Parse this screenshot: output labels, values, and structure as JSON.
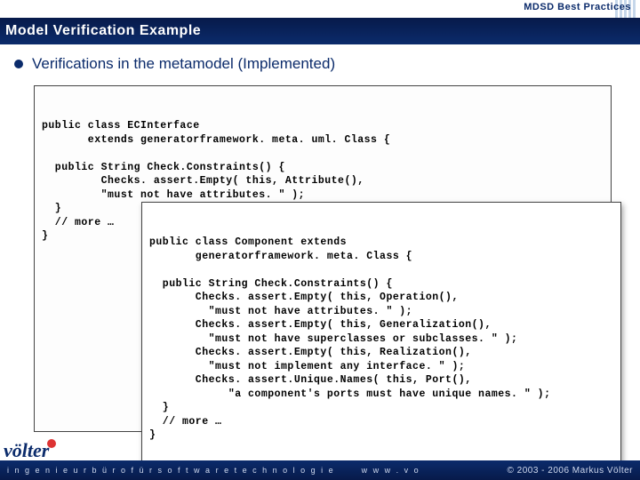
{
  "header": {
    "label": "MDSD Best Practices"
  },
  "title": "Model Verification Example",
  "bullet": "Verifications in the metamodel (Implemented)",
  "code_outer": "public class ECInterface\n       extends generatorframework. meta. uml. Class {\n\n  public String Check.Constraints() {\n         Checks. assert.Empty( this, Attribute(),\n         \"must not have attributes. \" );\n  }\n  // more …\n}",
  "code_inner": "public class Component extends\n       generatorframework. meta. Class {\n\n  public String Check.Constraints() {\n       Checks. assert.Empty( this, Operation(),\n         \"must not have attributes. \" );\n       Checks. assert.Empty( this, Generalization(),\n         \"must not have superclasses or subclasses. \" );\n       Checks. assert.Empty( this, Realization(),\n         \"must not implement any interface. \" );\n       Checks. assert.Unique.Names( this, Port(),\n            \"a component's ports must have unique names. \" );\n  }\n  // more …\n}",
  "logo": "völter",
  "footer": {
    "tagline": "i n g e n i e u r b ü r o   f ü r   s o f t w a r e t e c h n o l o g i e",
    "url": "w w w . v o",
    "copyright": "© 2003 - 2006 Markus Völter"
  }
}
